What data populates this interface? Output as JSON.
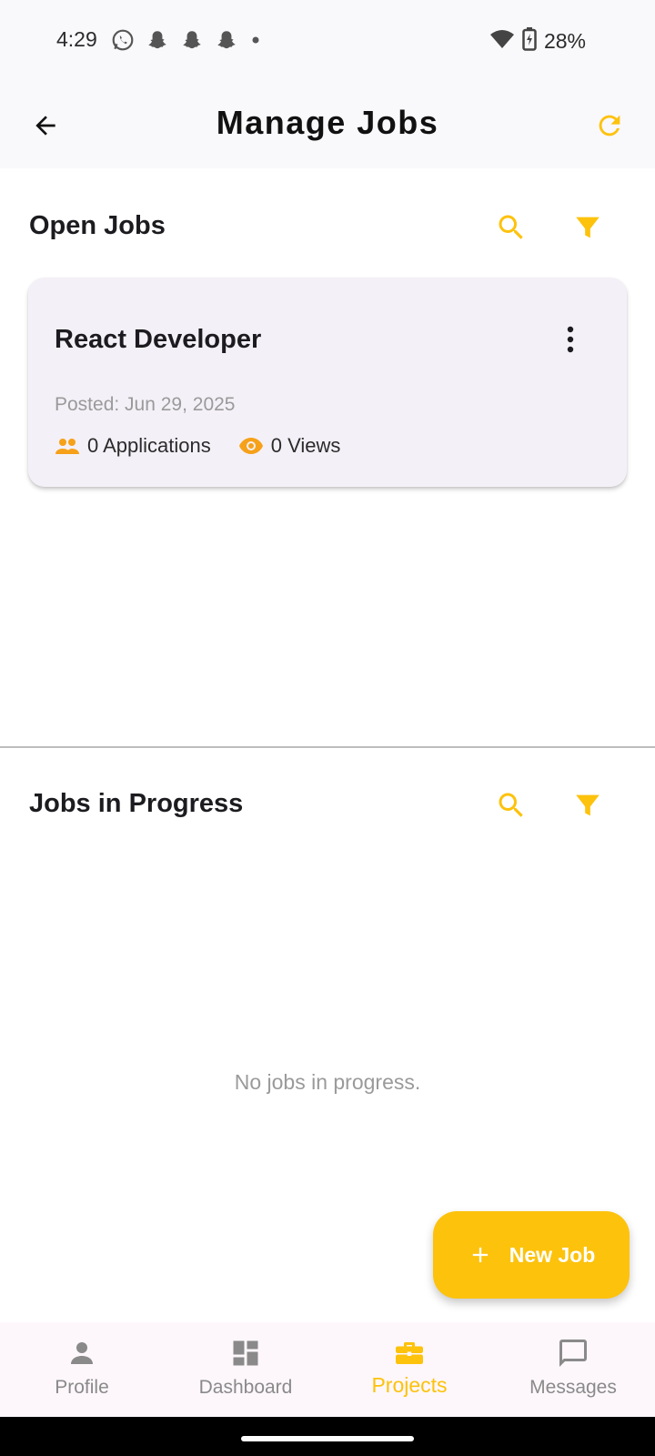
{
  "status_bar": {
    "time": "4:29",
    "battery_percent": "28%"
  },
  "app_bar": {
    "title": "Manage Jobs"
  },
  "open_jobs": {
    "title": "Open Jobs",
    "jobs": [
      {
        "title": "React Developer",
        "posted": "Posted: Jun 29, 2025",
        "applications": "0 Applications",
        "views": "0 Views"
      }
    ]
  },
  "in_progress": {
    "title": "Jobs in Progress",
    "empty_text": "No jobs in progress."
  },
  "fab": {
    "label": "New Job"
  },
  "bottom_nav": {
    "items": [
      {
        "label": "Profile",
        "icon": "person-icon"
      },
      {
        "label": "Dashboard",
        "icon": "dashboard-icon"
      },
      {
        "label": "Projects",
        "icon": "briefcase-icon",
        "active": true
      },
      {
        "label": "Messages",
        "icon": "message-icon"
      }
    ]
  },
  "colors": {
    "accent": "#fdc20c",
    "stat_icon": "#f6a11a",
    "inactive": "#8a8a8a"
  }
}
